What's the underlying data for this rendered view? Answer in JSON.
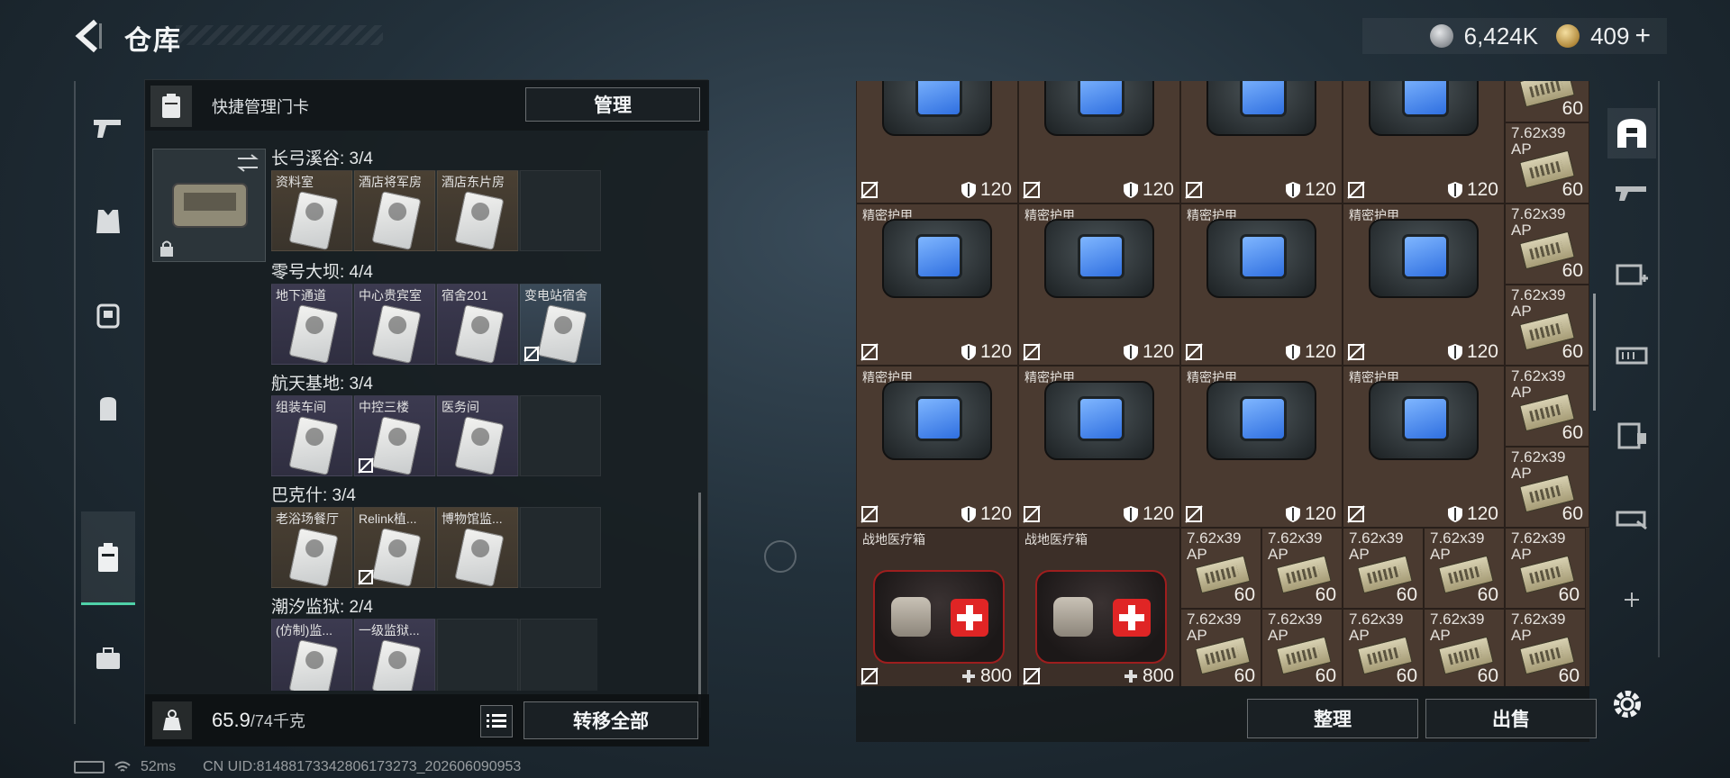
{
  "header": {
    "title": "仓库"
  },
  "currency": [
    {
      "icon": "silver-coin-icon",
      "value": "6,424K"
    },
    {
      "icon": "gold-coin-icon",
      "value": "409"
    }
  ],
  "currency_plus": "+",
  "left_nav": [
    "weapon-icon",
    "armor-icon",
    "backpack-icon",
    "rig-icon",
    "keycard-icon",
    "briefcase-icon"
  ],
  "card_panel": {
    "header_label": "快捷管理门卡",
    "manage_label": "管理",
    "groups": [
      {
        "title": "长弓溪谷: 3/4",
        "cards": [
          {
            "label": "资料室",
            "filled": true,
            "nosell": false,
            "tone": ""
          },
          {
            "label": "酒店将军房",
            "filled": true,
            "nosell": false,
            "tone": ""
          },
          {
            "label": "酒店东片房",
            "filled": true,
            "nosell": false,
            "tone": ""
          },
          {
            "label": "",
            "filled": false,
            "nosell": false,
            "tone": ""
          }
        ]
      },
      {
        "title": "零号大坝: 4/4",
        "cards": [
          {
            "label": "地下通道",
            "filled": true,
            "nosell": false,
            "tone": "purple"
          },
          {
            "label": "中心贵宾室",
            "filled": true,
            "nosell": false,
            "tone": "purple"
          },
          {
            "label": "宿舍201",
            "filled": true,
            "nosell": false,
            "tone": "purple"
          },
          {
            "label": "变电站宿舍",
            "filled": true,
            "nosell": true,
            "tone": "blue"
          }
        ]
      },
      {
        "title": "航天基地: 3/4",
        "cards": [
          {
            "label": "组装车间",
            "filled": true,
            "nosell": false,
            "tone": "purple"
          },
          {
            "label": "中控三楼",
            "filled": true,
            "nosell": true,
            "tone": "purple"
          },
          {
            "label": "医务间",
            "filled": true,
            "nosell": false,
            "tone": "purple"
          },
          {
            "label": "",
            "filled": false,
            "nosell": false,
            "tone": ""
          }
        ]
      },
      {
        "title": "巴克什: 3/4",
        "cards": [
          {
            "label": "老浴场餐厅",
            "filled": true,
            "nosell": false,
            "tone": ""
          },
          {
            "label": "Relink植...",
            "filled": true,
            "nosell": true,
            "tone": ""
          },
          {
            "label": "博物馆监...",
            "filled": true,
            "nosell": false,
            "tone": ""
          },
          {
            "label": "",
            "filled": false,
            "nosell": false,
            "tone": ""
          }
        ]
      },
      {
        "title": "潮汐监狱: 2/4",
        "cards": [
          {
            "label": "(仿制)监...",
            "filled": true,
            "nosell": false,
            "tone": "purple"
          },
          {
            "label": "一级监狱...",
            "filled": true,
            "nosell": false,
            "tone": "purple"
          },
          {
            "label": "",
            "filled": false,
            "nosell": false,
            "tone": ""
          },
          {
            "label": "",
            "filled": false,
            "nosell": false,
            "tone": ""
          }
        ]
      }
    ],
    "weight_current": "65.9",
    "weight_max": "/74千克",
    "transfer_all_label": "转移全部"
  },
  "stash": {
    "armor_name": "精密护甲",
    "armor_value": "120",
    "medkit_name": "战地医疗箱",
    "medkit_value": "800",
    "ammo_name": "7.62x39 AP",
    "ammo_value": "60",
    "sort_label": "整理",
    "sell_label": "出售"
  },
  "right_nav": [
    "stash-icon",
    "weapon-stash-icon",
    "medical-stash-icon",
    "ammo-stash-icon",
    "gear-stash-icon",
    "misc-stash-icon",
    "add-icon"
  ],
  "status": {
    "ping": "52ms",
    "uid": "CN UID:8148817334280617327​3_202606090953"
  },
  "colors": {
    "accent": "#4fd1a8",
    "stash_bg": "#3b2f27",
    "medkit_red": "#e02525"
  }
}
